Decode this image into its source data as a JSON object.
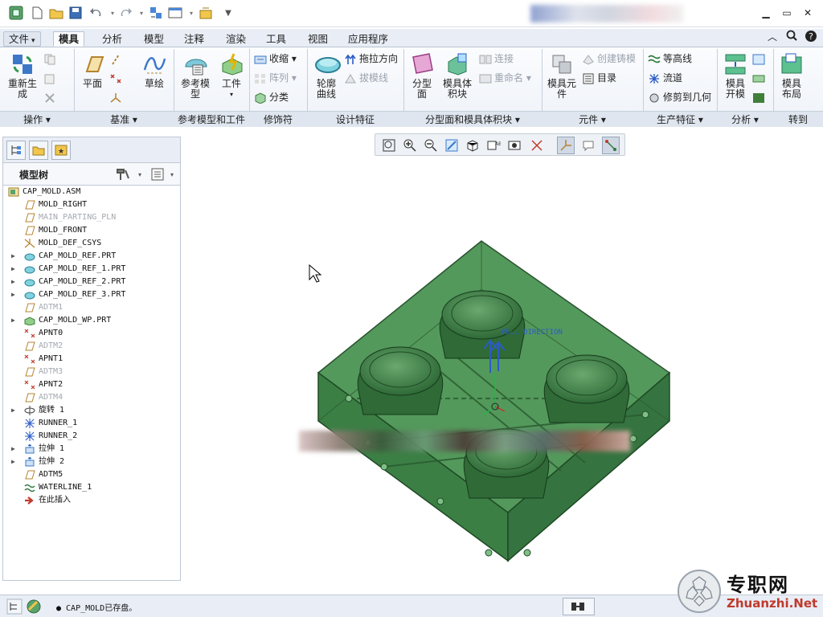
{
  "qat": {
    "icons": [
      "app-icon",
      "new-icon",
      "open-icon",
      "save-icon",
      "undo-icon",
      "redo-icon",
      "regenerate-icon",
      "windows-icon",
      "close-window-icon",
      "customize-icon"
    ]
  },
  "tabs": [
    {
      "label": "文件",
      "dropdown": "▾"
    },
    {
      "label": "模具"
    },
    {
      "label": "分析"
    },
    {
      "label": "模型"
    },
    {
      "label": "注释"
    },
    {
      "label": "渲染"
    },
    {
      "label": "工具"
    },
    {
      "label": "视图"
    },
    {
      "label": "应用程序"
    }
  ],
  "ribbon": {
    "groups": {
      "operations": "操作",
      "datum": "基准",
      "ref_model": "参考模型和工件",
      "modifiers": "修饰符",
      "design_features": "设计特征",
      "parting": "分型面和模具体积块",
      "components": "元件",
      "production": "生产特征",
      "analysis": "分析",
      "goto": "转到"
    },
    "regenerate": "重新生\n成",
    "plane": "平面",
    "sketch": "草绘",
    "ref_model_btn": "参考模\n型",
    "workpiece": "工件",
    "shrink": "收缩",
    "pattern": "阵列",
    "classify": "分类",
    "silhouette": "轮廓\n曲线",
    "pull_direction": "拖拉方向",
    "draft_check": "拔模线",
    "parting_surface": "分型\n面",
    "mold_volume": "模具体\n积块",
    "connect": "连接",
    "rename": "重命名",
    "mold_component": "模具元\n件",
    "create_casting": "创建铸模",
    "catalog": "目录",
    "waterline": "等高线",
    "runner": "流道",
    "trim_to_geom": "修剪到几何",
    "mold_open": "模具\n开模",
    "mold_layout": "模具\n布局"
  },
  "panel": {
    "title": "模型树"
  },
  "tree": [
    {
      "label": "CAP_MOLD.ASM",
      "icon": "assembly-icon",
      "expand": "",
      "gray": false,
      "root": true
    },
    {
      "label": "MOLD_RIGHT",
      "icon": "datum-plane-icon",
      "expand": "",
      "gray": false
    },
    {
      "label": "MAIN_PARTING_PLN",
      "icon": "datum-plane-icon",
      "expand": "",
      "gray": true
    },
    {
      "label": "MOLD_FRONT",
      "icon": "datum-plane-icon",
      "expand": "",
      "gray": false
    },
    {
      "label": "MOLD_DEF_CSYS",
      "icon": "csys-icon",
      "expand": "",
      "gray": false
    },
    {
      "label": "CAP_MOLD_REF.PRT",
      "icon": "part-icon",
      "expand": "▶",
      "gray": false
    },
    {
      "label": "CAP_MOLD_REF_1.PRT",
      "icon": "part-icon",
      "expand": "▶",
      "gray": false
    },
    {
      "label": "CAP_MOLD_REF_2.PRT",
      "icon": "part-icon",
      "expand": "▶",
      "gray": false
    },
    {
      "label": "CAP_MOLD_REF_3.PRT",
      "icon": "part-icon",
      "expand": "▶",
      "gray": false
    },
    {
      "label": "ADTM1",
      "icon": "datum-plane-icon",
      "expand": "",
      "gray": true
    },
    {
      "label": "CAP_MOLD_WP.PRT",
      "icon": "workpiece-icon",
      "expand": "▶",
      "gray": false
    },
    {
      "label": "APNT0",
      "icon": "datum-point-icon",
      "expand": "",
      "gray": false
    },
    {
      "label": "ADTM2",
      "icon": "datum-plane-icon",
      "expand": "",
      "gray": true
    },
    {
      "label": "APNT1",
      "icon": "datum-point-icon",
      "expand": "",
      "gray": false
    },
    {
      "label": "ADTM3",
      "icon": "datum-plane-icon",
      "expand": "",
      "gray": true
    },
    {
      "label": "APNT2",
      "icon": "datum-point-icon",
      "expand": "",
      "gray": false
    },
    {
      "label": "ADTM4",
      "icon": "datum-plane-icon",
      "expand": "",
      "gray": true
    },
    {
      "label": "旋转 1",
      "icon": "revolve-icon",
      "expand": "▶",
      "gray": false
    },
    {
      "label": "RUNNER_1",
      "icon": "runner-icon",
      "expand": "",
      "gray": false
    },
    {
      "label": "RUNNER_2",
      "icon": "runner-icon",
      "expand": "",
      "gray": false
    },
    {
      "label": "拉伸 1",
      "icon": "extrude-icon",
      "expand": "▶",
      "gray": false
    },
    {
      "label": "拉伸 2",
      "icon": "extrude-icon",
      "expand": "▶",
      "gray": false
    },
    {
      "label": "ADTM5",
      "icon": "datum-plane-icon",
      "expand": "",
      "gray": false
    },
    {
      "label": "WATERLINE_1",
      "icon": "waterline-icon",
      "expand": "",
      "gray": false
    },
    {
      "label": "在此插入",
      "icon": "insert-here-icon",
      "expand": "",
      "gray": false
    }
  ],
  "viewport": {
    "annotation": "PULL DIRECTION"
  },
  "status": {
    "message": "● CAP_MOLD已存盘。"
  },
  "watermark": {
    "cn": "专职网",
    "en": "Zhuanzhi.Net"
  },
  "colors": {
    "model_green": "#3f8a49",
    "ribbon_bg": "#eef2f8",
    "accent_blue": "#2a5cc6"
  }
}
